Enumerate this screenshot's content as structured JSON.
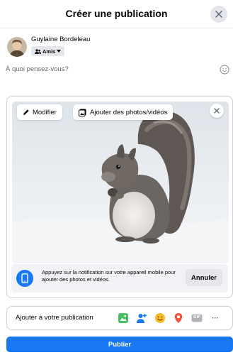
{
  "dialog": {
    "title": "Créer une publication"
  },
  "user": {
    "name": "Guylaine Bordeleau",
    "audience_label": "Amis"
  },
  "composer": {
    "placeholder": "À quoi pensez-vous?"
  },
  "media": {
    "edit_label": "Modifier",
    "add_photos_label": "Ajouter des photos/vidéos"
  },
  "mobile_notice": {
    "text": "Appuyez sur la notification sur votre appareil mobile pour ajouter des photos et vidéos.",
    "cancel_label": "Annuler"
  },
  "add_to_post": {
    "label": "Ajouter à votre publication",
    "tools": [
      "photo-video-icon",
      "tag-people-icon",
      "feeling-icon",
      "check-in-icon",
      "gif-icon",
      "more-icon"
    ],
    "gif_text": "GIF",
    "more_text": "···"
  },
  "publish": {
    "label": "Publier"
  },
  "colors": {
    "brand_blue": "#1877f2",
    "photo_green": "#45bd62",
    "tag_blue": "#1877f2",
    "feeling_yellow": "#f7b928",
    "checkin_red": "#f5533d",
    "gif_gray": "#b0b3b8"
  }
}
